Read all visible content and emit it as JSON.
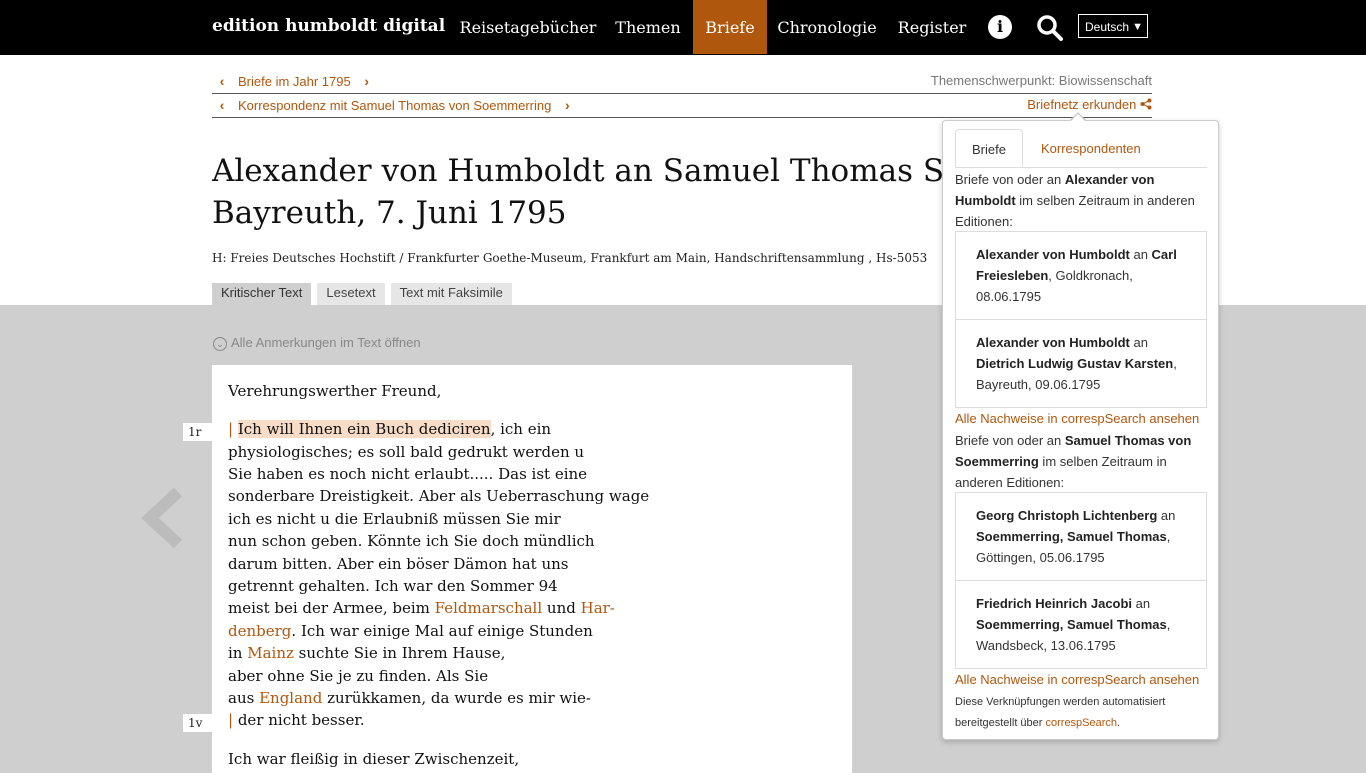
{
  "header": {
    "brand": "edition humboldt digital",
    "nav": [
      "Reisetagebücher",
      "Themen",
      "Briefe",
      "Chronologie",
      "Register"
    ],
    "active_nav": "Briefe",
    "language": "Deutsch"
  },
  "breadcrumbs": {
    "year_link": "Briefe im Jahr 1795",
    "correspondence_link": "Korrespondenz mit Samuel Thomas von Soemmerring",
    "theme_label": "Themenschwerpunkt: Biowissenschaft",
    "network_link": "Briefnetz erkunden"
  },
  "document": {
    "title_line1": "Alexander von Humboldt an Samuel Thomas Soemmerring",
    "title_line2": "Bayreuth, 7. Juni 1795",
    "source": "H: Freies Deutsches Hochstift / Frankfurter Goethe-Museum, Frankfurt am Main, Handschriftensammlung , Hs-5053",
    "tabs": [
      "Kritischer Text",
      "Lesetext",
      "Text mit Faksimile"
    ],
    "active_tab": "Kritischer Text",
    "open_notes": "Alle Anmerkungen im Text öffnen"
  },
  "letter": {
    "salutation": "Verehrungswerther Freund,",
    "folio_1": "1r",
    "folio_2": "1v",
    "l1_bar": "|",
    "l1_hl": "Ich will Ihnen ein Buch dediciren",
    "l1_rest": ", ich ein",
    "l2": "physiologisches; es soll bald gedrukt werden u",
    "l3": "Sie haben es noch nicht erlaubt..... Das ist eine",
    "l4": "sonderbare Dreistigkeit. Aber als Ueberraschung wage",
    "l5": "ich es nicht u die Erlaubniß müssen Sie mir",
    "l6": "nun schon geben. Könnte ich Sie doch mündlich",
    "l7": "darum bitten. Aber ein böser Dämon hat uns",
    "l8": "getrennt gehalten. Ich war den Sommer 94",
    "l9_a": "meist bei der Armee, beim ",
    "l9_link1": "Feldmarschall",
    "l9_b": " und ",
    "l9_link2": "Har-",
    "l10_link": "denberg",
    "l10_rest": ". Ich war einige Mal auf einige Stunden",
    "l11_a": "in ",
    "l11_link": "Mainz",
    "l11_rest": " suchte Sie in Ihrem Hause,",
    "l12": "aber ohne Sie je zu finden. Als Sie",
    "l13_a": "aus ",
    "l13_link": "England",
    "l13_rest": " zurükkamen, da wurde es mir wie-",
    "l14_bar": "|",
    "l14": " der nicht besser.",
    "l15": "Ich war fleißig in dieser Zwischenzeit,"
  },
  "popover": {
    "tab_letters": "Briefe",
    "tab_correspondents": "Korrespondenten",
    "intro1_a": "Briefe von oder an ",
    "intro1_b": "Alexander von Humboldt",
    "intro1_c": " im selben Zeitraum in anderen Editionen:",
    "group1": [
      {
        "from": "Alexander von Humboldt",
        "mid": " an ",
        "to": "Carl Freiesleben",
        "rest": ", Goldkronach, 08.06.1795"
      },
      {
        "from": "Alexander von Humboldt",
        "mid": " an ",
        "to": "Dietrich Ludwig Gustav Karsten",
        "rest": ", Bayreuth, 09.06.1795"
      }
    ],
    "all_link": "Alle Nachweise in correspSearch ansehen",
    "intro2_a": "Briefe von oder an ",
    "intro2_b": "Samuel Thomas von Soemmerring",
    "intro2_c": " im selben Zeitraum in anderen Editionen:",
    "group2": [
      {
        "from": "Georg Christoph Lichtenberg",
        "mid": " an ",
        "to": "Soemmerring, Samuel Thomas",
        "rest": ", Göttingen, 05.06.1795"
      },
      {
        "from": "Friedrich Heinrich Jacobi",
        "mid": " an ",
        "to": "Soemmerring, Samuel Thomas",
        "rest": ", Wandsbeck, 13.06.1795"
      }
    ],
    "note_a": "Diese Verknüpfungen werden automatisiert bereitgestellt über ",
    "note_link": "correspSearch",
    "note_end": "."
  },
  "colors": {
    "accent": "#b0570e",
    "header_bg": "#000000",
    "content_bg": "#cfcfcf",
    "highlight": "#f7dcc7"
  }
}
